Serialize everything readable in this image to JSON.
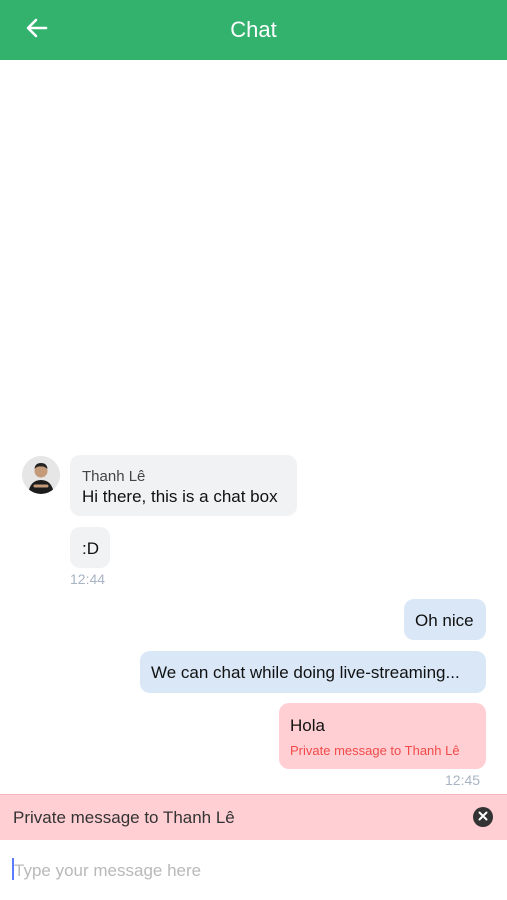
{
  "header": {
    "title": "Chat",
    "back_icon": "arrow-left-icon"
  },
  "messages": {
    "incoming": {
      "sender": "Thanh Lê",
      "text1": "Hi there, this is a chat box",
      "text2": ":D",
      "time": "12:44"
    },
    "outgoing": {
      "text1": "Oh nice",
      "text2": "We can chat while doing live-streaming...",
      "text3": "Hola",
      "private_note": "Private message to Thanh Lê",
      "time": "12:45"
    }
  },
  "private_bar": {
    "text": "Private message to Thanh Lê",
    "close_icon": "close-icon"
  },
  "composer": {
    "placeholder": "Type your message here",
    "value": ""
  },
  "colors": {
    "header": "#33b26e",
    "incoming_bubble": "#f1f2f4",
    "outgoing_bubble": "#d9e7f7",
    "private_bubble": "#ffcfd4",
    "private_note": "#f24a48",
    "timestamp": "#a8b4c4"
  }
}
